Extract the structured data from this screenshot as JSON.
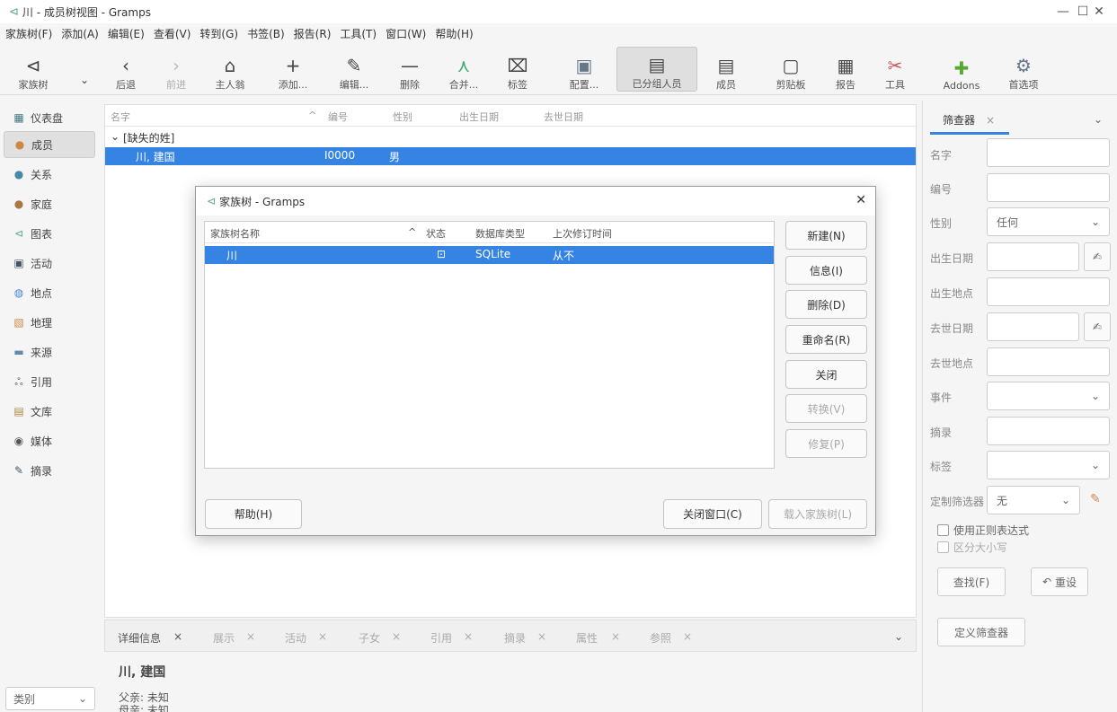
{
  "window": {
    "title": "川 - 成员树视图 - Gramps"
  },
  "menu": [
    "家族树(F)",
    "添加(A)",
    "编辑(E)",
    "查看(V)",
    "转到(G)",
    "书签(B)",
    "报告(R)",
    "工具(T)",
    "窗口(W)",
    "帮助(H)"
  ],
  "toolbar": {
    "family_trees": "家族树",
    "back": "后退",
    "forward": "前进",
    "home": "主人翁",
    "add": "添加...",
    "edit": "编辑...",
    "delete": "删除",
    "merge": "合并...",
    "tag": "标签",
    "configure": "配置...",
    "grouped_people": "已分组人员",
    "people": "成员",
    "clipboard": "剪贴板",
    "reports": "报告",
    "tools": "工具",
    "addons": "Addons",
    "preferences": "首选项"
  },
  "sidebar": {
    "items": [
      "仪表盘",
      "成员",
      "关系",
      "家庭",
      "图表",
      "活动",
      "地点",
      "地理",
      "来源",
      "引用",
      "文库",
      "媒体",
      "摘录"
    ],
    "category_select": "类别"
  },
  "main": {
    "columns": [
      "名字",
      "编号",
      "性别",
      "出生日期",
      "去世日期"
    ],
    "group_label": "[缺失的姓]",
    "rows": [
      {
        "name": "川, 建国",
        "id": "I0000",
        "gender": "男"
      }
    ]
  },
  "bottom_tabs": [
    "详细信息",
    "展示",
    "活动",
    "子女",
    "引用",
    "摘录",
    "属性",
    "参照"
  ],
  "details": {
    "name": "川, 建国",
    "father": "父亲:  未知",
    "mother": "母亲:  未知"
  },
  "filter": {
    "tab": "筛查器",
    "labels": {
      "name": "名字",
      "id": "编号",
      "gender": "性别",
      "birth_date": "出生日期",
      "birth_place": "出生地点",
      "death_date": "去世日期",
      "death_place": "去世地点",
      "event": "事件",
      "note": "摘录",
      "tag": "标签",
      "custom": "定制筛选器"
    },
    "gender_value": "任何",
    "custom_value": "无",
    "regex": "使用正则表达式",
    "case": "区分大小写",
    "find": "查找(F)",
    "reset": "重设",
    "define": "定义筛查器"
  },
  "dialog": {
    "title": "家族树 - Gramps",
    "columns": [
      "家族树名称",
      "状态",
      "数据库类型",
      "上次修订时间"
    ],
    "rows": [
      {
        "name": "川",
        "db_type": "SQLite",
        "last_modified": "从不"
      }
    ],
    "buttons": {
      "new": "新建(N)",
      "info": "信息(I)",
      "delete": "删除(D)",
      "rename": "重命名(R)",
      "close": "关闭",
      "convert": "转换(V)",
      "repair": "修复(P)"
    },
    "help": "帮助(H)",
    "close_window": "关闭窗口(C)",
    "load": "载入家族树(L)"
  }
}
